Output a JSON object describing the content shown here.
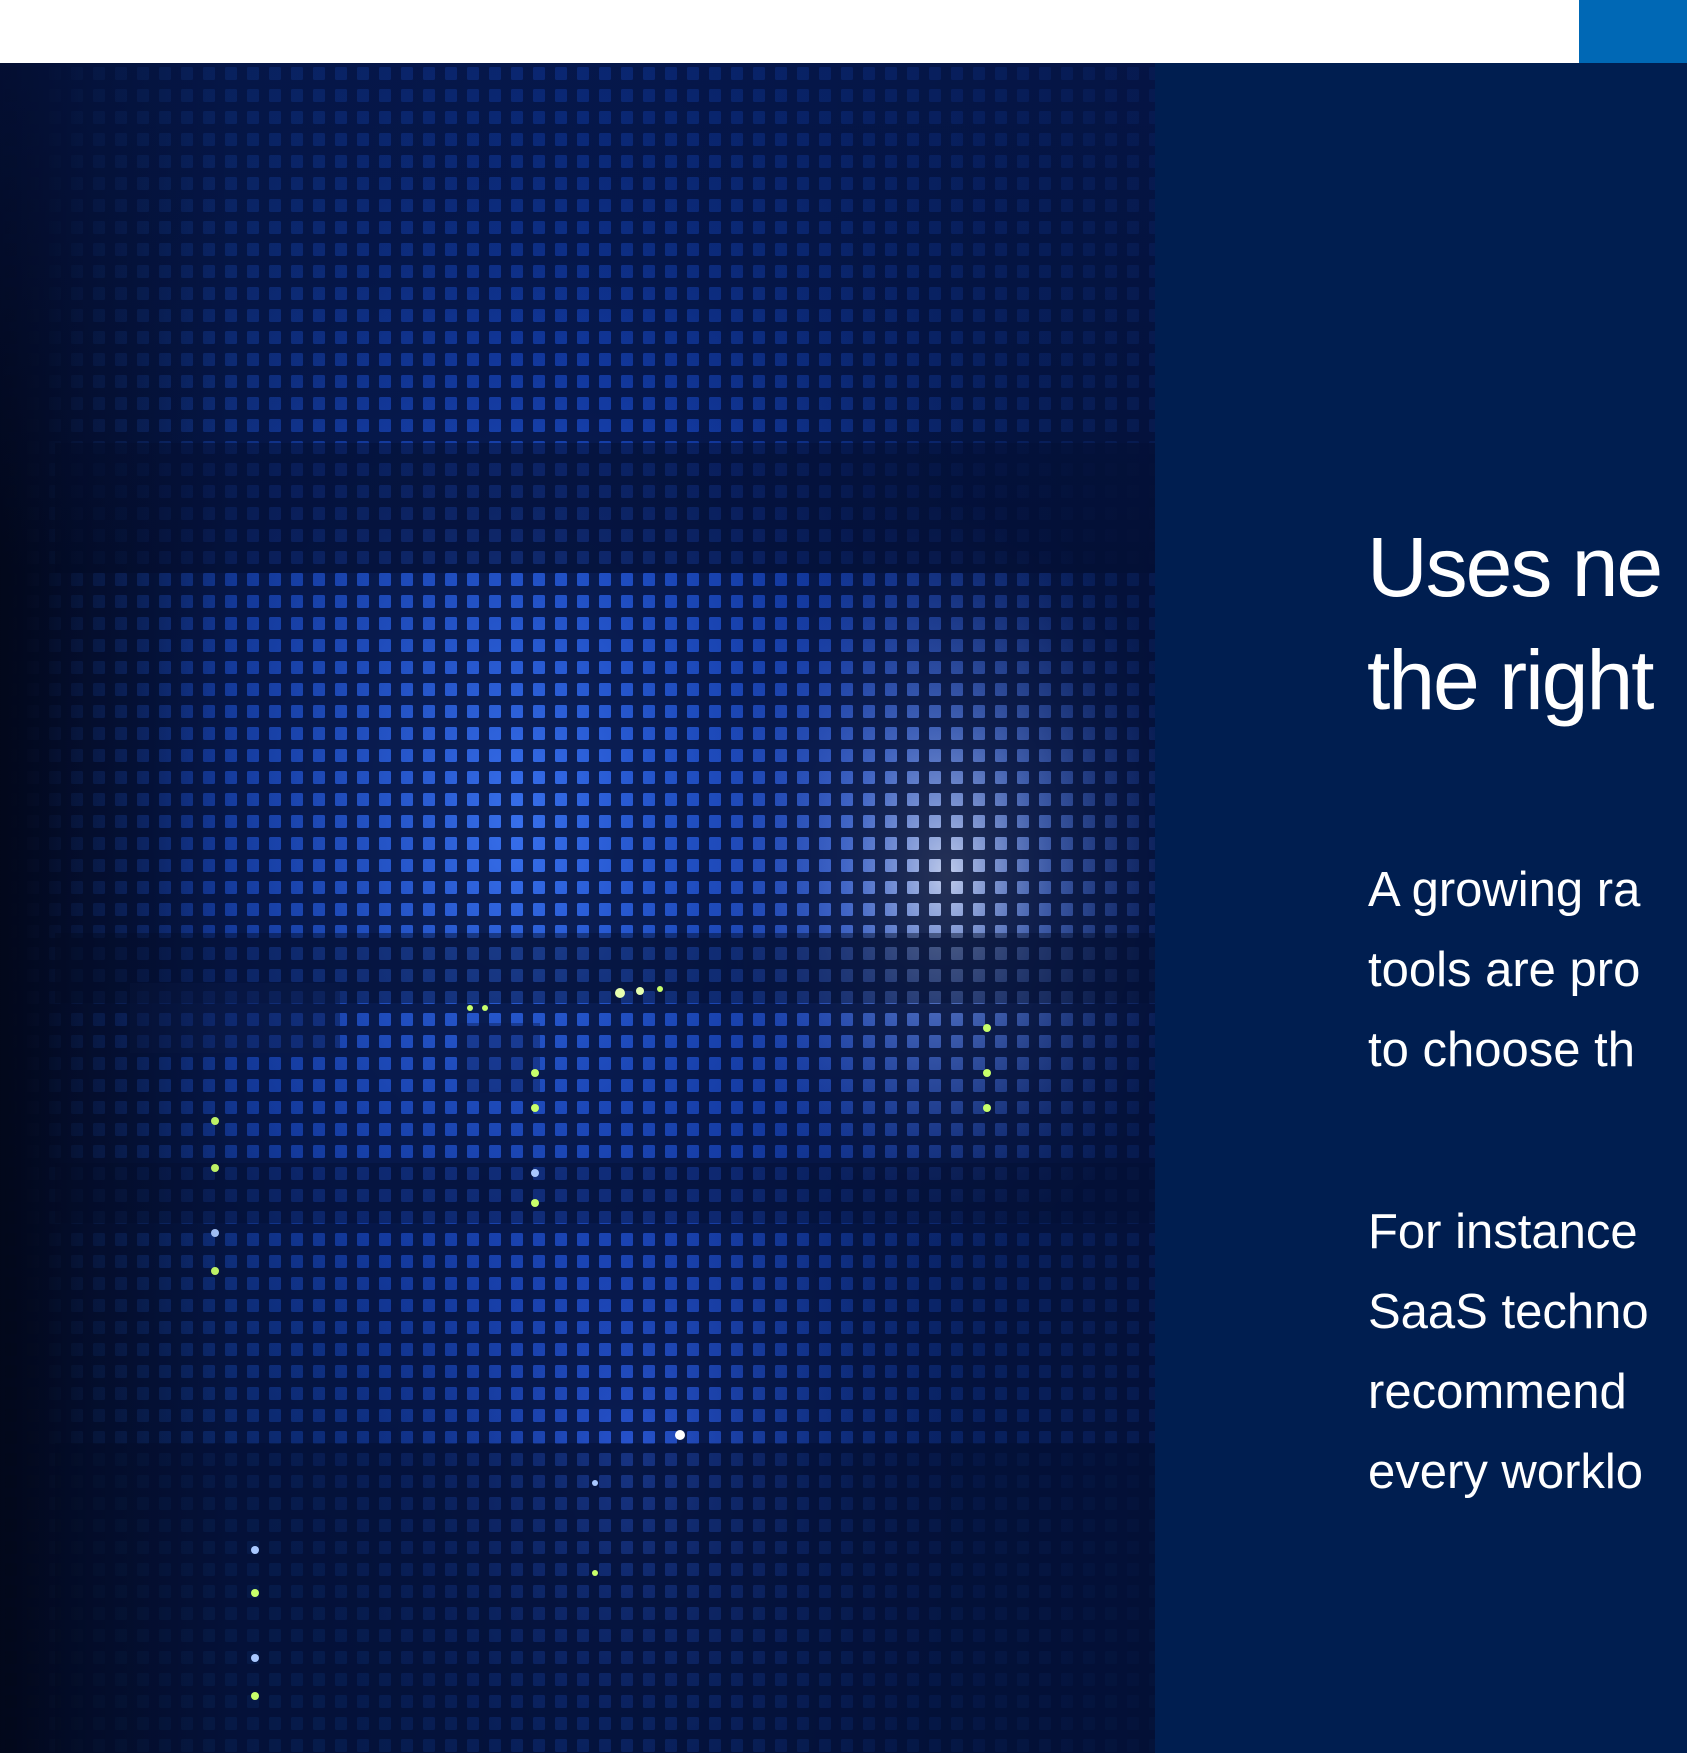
{
  "colors": {
    "page_background": "#ffffff",
    "top_accent": "#0068b5",
    "panel_background": "#001e50",
    "text": "#ffffff",
    "photo_glow": "#2f6bff",
    "led_green": "#c8ff6a",
    "led_blue": "#a9c8ff"
  },
  "image": {
    "subject": "server-rack-mesh-photo"
  },
  "content": {
    "heading_lines": [
      "Uses ne",
      "the right"
    ],
    "paragraph_1_lines": [
      "A growing ra",
      "tools are pro",
      "to choose th"
    ],
    "paragraph_2_lines": [
      "For instance",
      "SaaS techno",
      "recommend",
      "every worklo"
    ]
  }
}
